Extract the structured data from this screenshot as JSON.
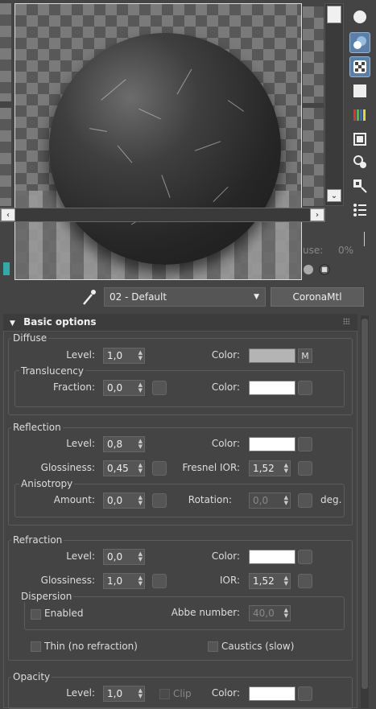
{
  "preview": {
    "zoom_label": "use:",
    "zoom_value": "0%"
  },
  "material_name": "02 - Default",
  "material_type": "CoronaMtl",
  "rollout_title": "Basic options",
  "diffuse": {
    "group": "Diffuse",
    "level_label": "Level:",
    "level": "1,0",
    "color_label": "Color:",
    "color": "#b4b4b4",
    "map_label": "M",
    "translucency": {
      "group": "Translucency",
      "fraction_label": "Fraction:",
      "fraction": "0,0",
      "color_label": "Color:",
      "color": "#ffffff"
    }
  },
  "reflection": {
    "group": "Reflection",
    "level_label": "Level:",
    "level": "0,8",
    "color_label": "Color:",
    "color": "#ffffff",
    "glossiness_label": "Glossiness:",
    "glossiness": "0,45",
    "fresnel_label": "Fresnel IOR:",
    "fresnel": "1,52",
    "anisotropy": {
      "group": "Anisotropy",
      "amount_label": "Amount:",
      "amount": "0,0",
      "rotation_label": "Rotation:",
      "rotation": "0,0",
      "unit": "deg."
    }
  },
  "refraction": {
    "group": "Refraction",
    "level_label": "Level:",
    "level": "0,0",
    "color_label": "Color:",
    "color": "#ffffff",
    "glossiness_label": "Glossiness:",
    "glossiness": "1,0",
    "ior_label": "IOR:",
    "ior": "1,52",
    "dispersion": {
      "group": "Dispersion",
      "enabled_label": "Enabled",
      "abbe_label": "Abbe number:",
      "abbe": "40,0"
    },
    "thin_label": "Thin (no refraction)",
    "caustics_label": "Caustics (slow)"
  },
  "opacity": {
    "group": "Opacity",
    "level_label": "Level:",
    "level": "1,0",
    "clip_label": "Clip",
    "color_label": "Color:",
    "color": "#ffffff"
  }
}
